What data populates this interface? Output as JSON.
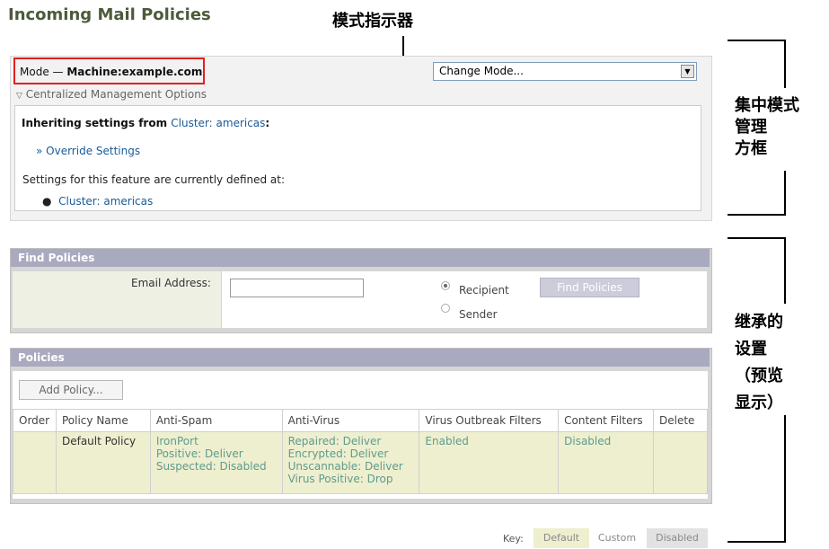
{
  "page_title": "Incoming Mail Policies",
  "callouts": {
    "mode_indicator": "模式指示器",
    "centralized_box": [
      "集中模式",
      "管理",
      "方框"
    ],
    "inherited_settings": [
      "继承的",
      "设置",
      "（预览",
      "显示）"
    ]
  },
  "mode": {
    "prefix": "Mode —",
    "value": "Machine:example.com",
    "change_mode_placeholder": "Change Mode...",
    "cmo_toggle": "Centralized Management Options",
    "inheriting_prefix": "Inheriting settings from",
    "inheriting_link": "Cluster: americas",
    "inheriting_suffix": ":",
    "override_link": "» Override Settings",
    "settings_defined_text": "Settings for this feature are currently defined at:",
    "defined_at_link": "Cluster: americas"
  },
  "find": {
    "header": "Find Policies",
    "email_label": "Email Address:",
    "email_value": "",
    "radio_recipient": "Recipient",
    "radio_sender": "Sender",
    "button": "Find Policies"
  },
  "policies": {
    "header": "Policies",
    "add_button": "Add Policy...",
    "columns": [
      "Order",
      "Policy Name",
      "Anti-Spam",
      "Anti-Virus",
      "Virus Outbreak Filters",
      "Content Filters",
      "Delete"
    ],
    "row": {
      "order": "",
      "name": "Default Policy",
      "anti_spam": [
        "IronPort",
        "Positive: Deliver",
        "Suspected: Disabled"
      ],
      "anti_virus": [
        "Repaired: Deliver",
        "Encrypted: Deliver",
        "Unscannable: Deliver",
        "Virus Positive: Drop"
      ],
      "vof": "Enabled",
      "content_filters": "Disabled",
      "delete": ""
    }
  },
  "key": {
    "label": "Key:",
    "default": "Default",
    "custom": "Custom",
    "disabled": "Disabled"
  },
  "colors": {
    "title": "#4d5a3a",
    "panel_header": "#a9a9bf",
    "policy_row": "#eeefcf",
    "link": "#1a5a9a",
    "highlight": "#e02020"
  }
}
